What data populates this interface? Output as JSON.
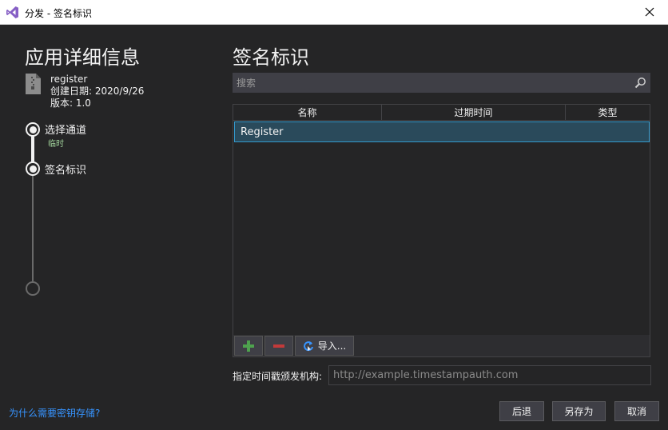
{
  "window": {
    "title": "分发 - 签名标识"
  },
  "left": {
    "heading": "应用详细信息",
    "app_name": "register",
    "created": "创建日期: 2020/9/26",
    "version": "版本: 1.0",
    "steps": [
      {
        "label": "选择通道",
        "sub": "临时"
      },
      {
        "label": "签名标识"
      }
    ],
    "why_link": "为什么需要密钥存储?"
  },
  "right": {
    "heading": "签名标识",
    "search_placeholder": "搜索",
    "columns": [
      "名称",
      "过期时间",
      "类型"
    ],
    "rows": [
      {
        "name": "Register"
      }
    ],
    "import_label": "导入...",
    "timestamp_label": "指定时间戳颁发机构:",
    "timestamp_placeholder": "http://example.timestampauth.com"
  },
  "buttons": {
    "back": "后退",
    "save_as": "另存为",
    "cancel": "取消"
  },
  "colors": {
    "background": "#252526",
    "accent": "#3399cc",
    "link": "#3794ff",
    "add": "#4ea24e",
    "remove": "#c23a3a",
    "vs_purple": "#865fc5"
  }
}
